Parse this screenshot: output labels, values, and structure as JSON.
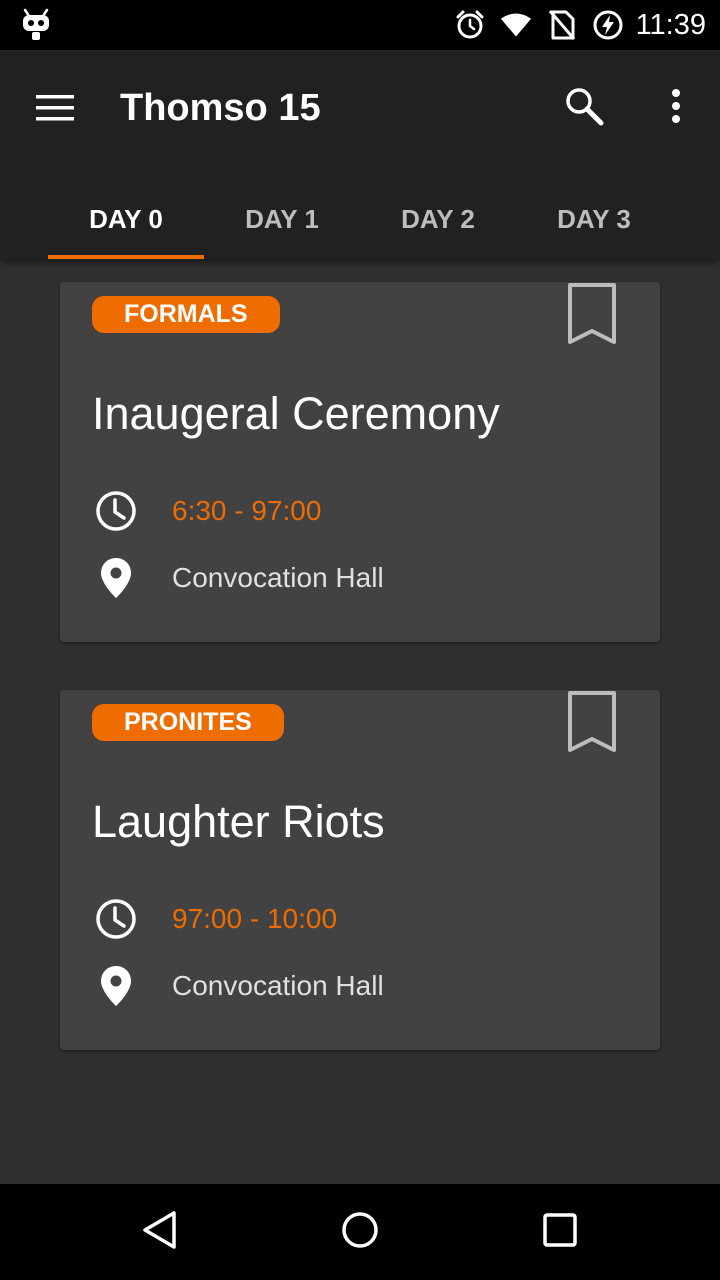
{
  "status_bar": {
    "time": "11:39",
    "icons": [
      "android-debug-icon",
      "alarm-icon",
      "wifi-icon",
      "no-sim-icon",
      "battery-charging-icon"
    ]
  },
  "app_bar": {
    "title": "Thomso 15",
    "icons": [
      "menu-icon",
      "search-icon",
      "more-vert-icon"
    ]
  },
  "tabs": [
    {
      "label": "DAY 0",
      "active": true
    },
    {
      "label": "DAY 1",
      "active": false
    },
    {
      "label": "DAY 2",
      "active": false
    },
    {
      "label": "DAY 3",
      "active": false
    }
  ],
  "events": [
    {
      "category": "FORMALS",
      "title": "Inaugeral Ceremony",
      "time": "6:30 - 97:00",
      "venue": "Convocation Hall"
    },
    {
      "category": "PRONITES",
      "title": "Laughter Riots",
      "time": "97:00 - 10:00",
      "venue": "Convocation Hall"
    }
  ],
  "colors": {
    "accent": "#ef6c00",
    "app_bar": "#212121",
    "background": "#303030",
    "card": "#424242"
  },
  "nav_bar": {
    "icons": [
      "back-icon",
      "home-icon",
      "recents-icon"
    ]
  }
}
